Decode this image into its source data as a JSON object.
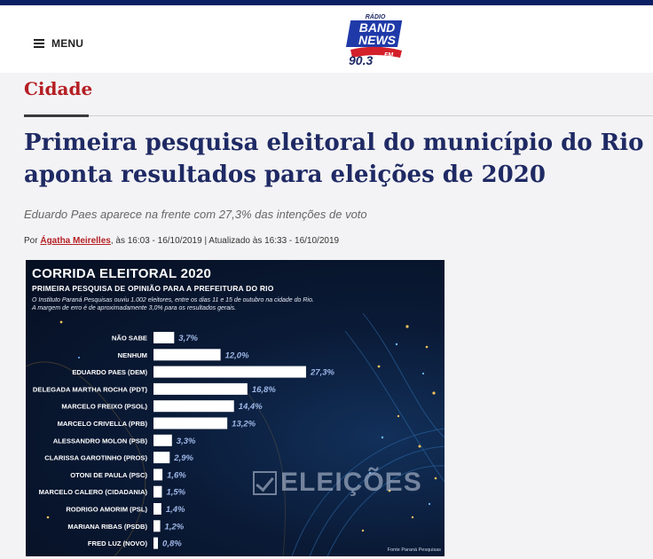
{
  "header": {
    "menu_label": "MENU",
    "logo": {
      "top": "RÁDIO",
      "line1": "BAND",
      "line2": "NEWS",
      "freq": "90.3",
      "band": "FM"
    }
  },
  "colors": {
    "brand_blue": "#1f2a64",
    "section_red": "#b51f24",
    "top_bar": "#0b1f63",
    "bar_fill": "#ffffff",
    "value_blue": "#9fb8e8"
  },
  "article": {
    "section": "Cidade",
    "headline": "Primeira pesquisa eleitoral do município do Rio aponta resultados para eleições de 2020",
    "subtitle": "Eduardo Paes aparece na frente com 27,3% das intenções de voto",
    "byline": {
      "prefix": "Por",
      "author": "Ágatha Meirelles",
      "date": ", às 16:03 - 16/10/2019 | Atualizado às 16:33 - 16/10/2019"
    }
  },
  "infographic": {
    "title": "CORRIDA ELEITORAL 2020",
    "subtitle": "PRIMEIRA PESQUISA DE OPINIÃO PARA A PREFEITURA DO RIO",
    "note_line1": "O Instituto Paraná Pesquisas ouviu 1.002 eleitores, entre os dias 11 e 15 de outubro na cidade do Rio.",
    "note_line2": "A margem de erro é de aproximadamente 3,0% para os resultados gerais.",
    "watermark": "ELEIÇÕES",
    "source": "Fonte Paraná Pesquisas"
  },
  "chart_data": {
    "type": "bar",
    "orientation": "horizontal",
    "categories": [
      "NÃO SABE",
      "NENHUM",
      "EDUARDO PAES (DEM)",
      "DELEGADA MARTHA ROCHA (PDT)",
      "MARCELO FREIXO (PSOL)",
      "MARCELO CRIVELLA (PRB)",
      "ALESSANDRO MOLON (PSB)",
      "CLARISSA GAROTINHO (PROS)",
      "OTONI DE PAULA (PSC)",
      "MARCELO CALERO (CIDADANIA)",
      "RODRIGO AMORIM (PSL)",
      "MARIANA RIBAS (PSDB)",
      "FRED LUZ (NOVO)"
    ],
    "values": [
      3.7,
      12.0,
      27.3,
      16.8,
      14.4,
      13.2,
      3.3,
      2.9,
      1.6,
      1.5,
      1.4,
      1.2,
      0.8
    ],
    "value_labels": [
      "3,7%",
      "12,0%",
      "27,3%",
      "16,8%",
      "14,4%",
      "13,2%",
      "3,3%",
      "2,9%",
      "1,6%",
      "1,5%",
      "1,4%",
      "1,2%",
      "0,8%"
    ],
    "xlim": [
      0,
      30
    ]
  }
}
